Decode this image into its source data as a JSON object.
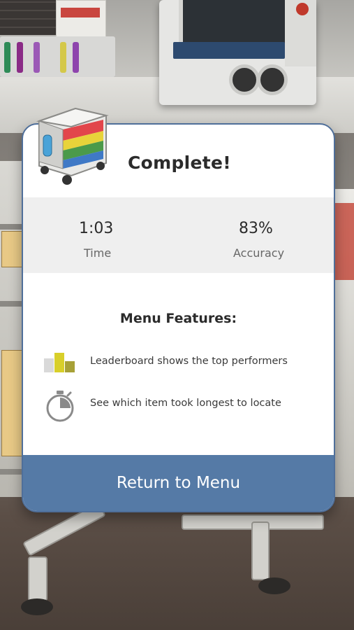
{
  "dialog": {
    "title": "Complete!",
    "stats": [
      {
        "value": "1:03",
        "label": "Time"
      },
      {
        "value": "83%",
        "label": "Accuracy"
      }
    ],
    "features_title": "Menu Features:",
    "features": [
      {
        "icon": "leaderboard-icon",
        "text": "Leaderboard shows the top performers"
      },
      {
        "icon": "stopwatch-icon",
        "text": "See which item took longest to locate"
      }
    ],
    "return_button_label": "Return to Menu"
  },
  "colors": {
    "accent": "#557aa6",
    "card_border": "#4f6f9a",
    "stats_bg": "#efefef",
    "leaderboard_yellow": "#d8cf2a",
    "leaderboard_olive": "#a7a137"
  }
}
